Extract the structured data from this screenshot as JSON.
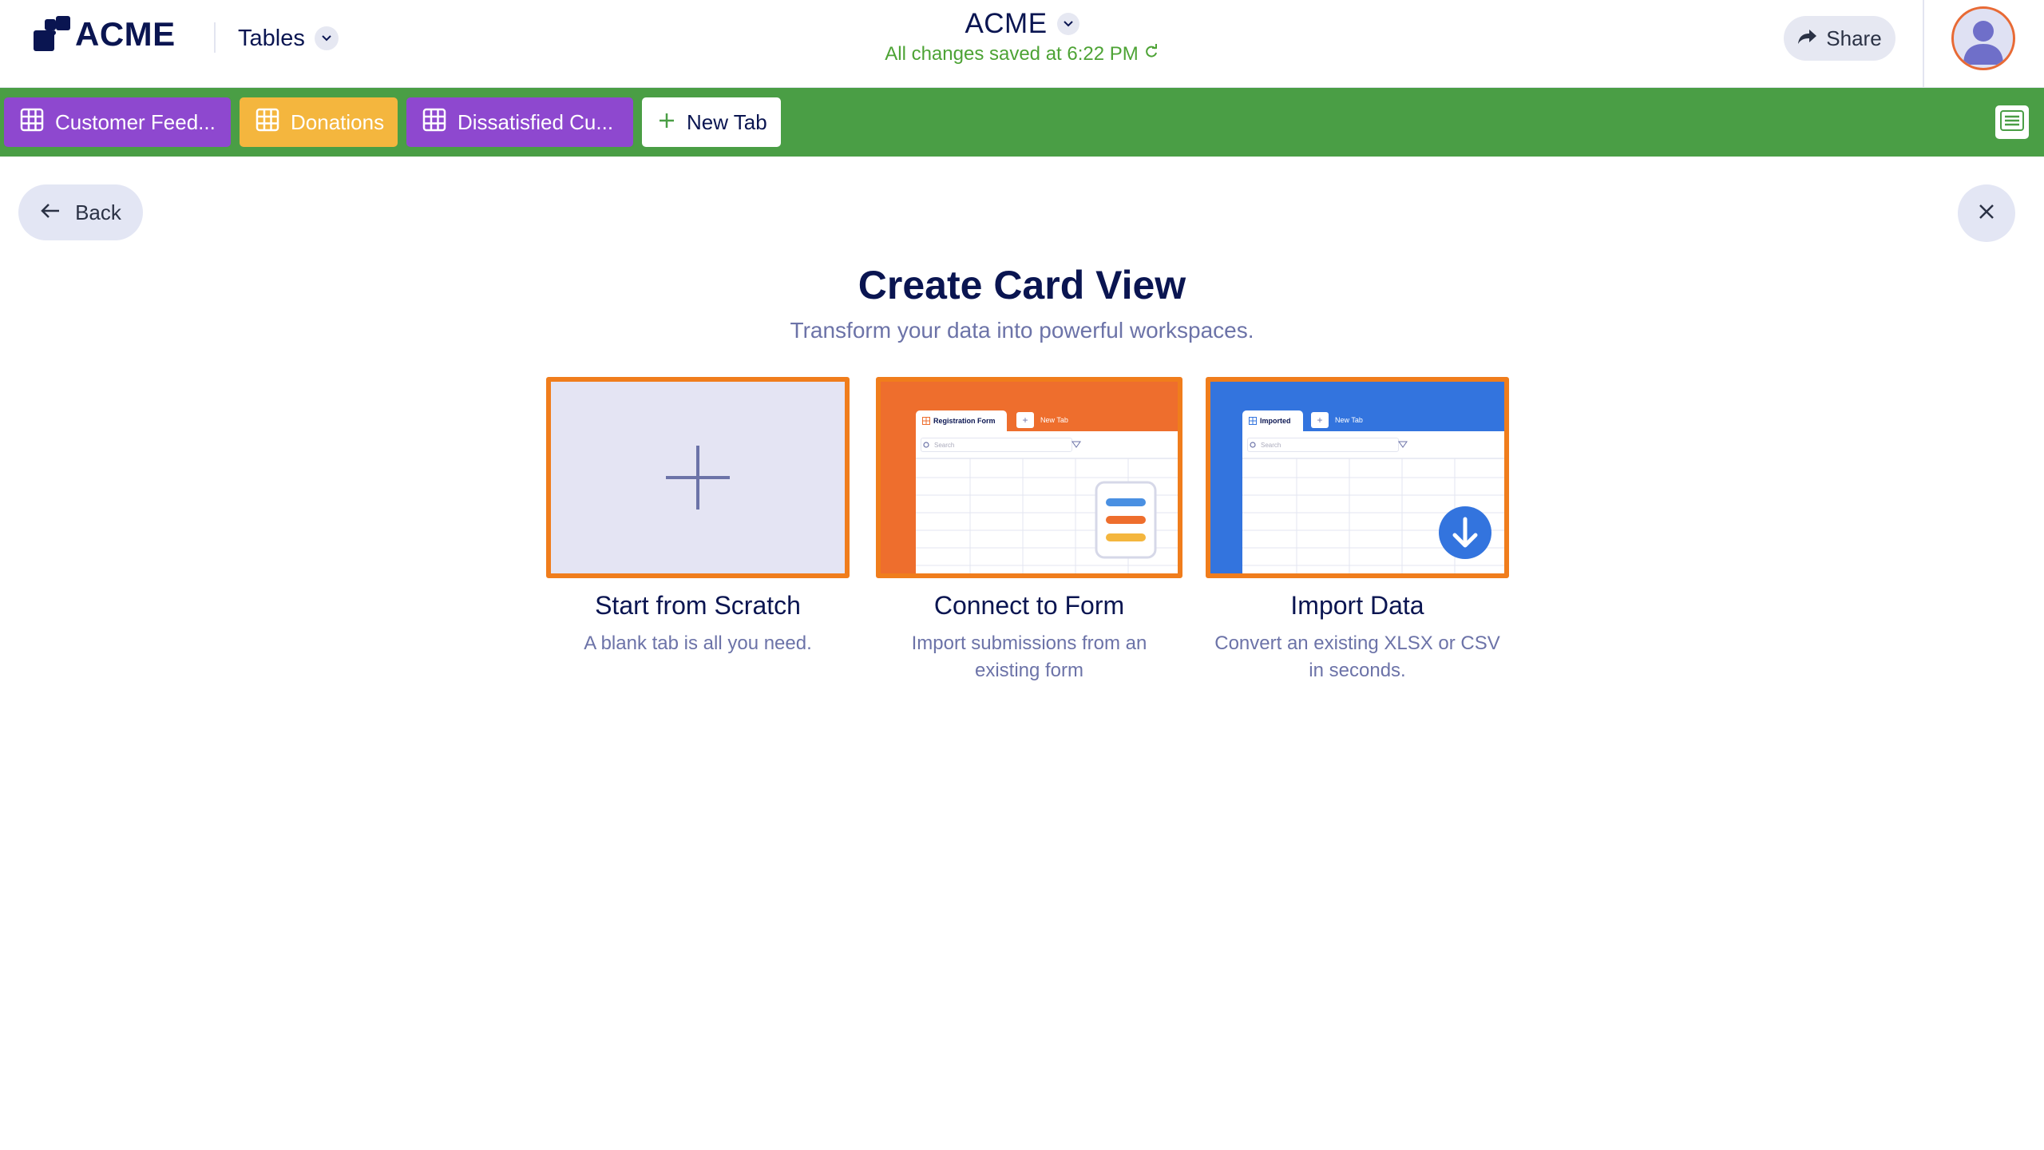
{
  "header": {
    "logo_text": "ACME",
    "tables_label": "Tables",
    "app_title": "ACME",
    "save_status": "All changes saved at 6:22 PM",
    "share_label": "Share"
  },
  "tabs": [
    {
      "label": "Customer Feed...",
      "color": "#8e48cf"
    },
    {
      "label": "Donations",
      "color": "#f4b63e"
    },
    {
      "label": "Dissatisfied Cu...",
      "color": "#8e48cf"
    }
  ],
  "new_tab_label": "New Tab",
  "nav": {
    "back_label": "Back"
  },
  "page": {
    "title": "Create Card View",
    "subtitle": "Transform your data into powerful workspaces."
  },
  "options": [
    {
      "title": "Start from Scratch",
      "desc": "A blank tab is all you need."
    },
    {
      "title": "Connect to Form",
      "desc": "Import submissions from an existing form",
      "preview": {
        "tab_label": "Registration Form",
        "new_tab_label": "New Tab",
        "search_placeholder": "Search"
      }
    },
    {
      "title": "Import Data",
      "desc": "Convert an existing XLSX or CSV in seconds.",
      "preview": {
        "tab_label": "Imported",
        "new_tab_label": "New Tab",
        "search_placeholder": "Search"
      }
    }
  ],
  "colors": {
    "brand_navy": "#0a1551",
    "tabbar_green": "#4a9e45",
    "highlight_orange": "#f07d1c",
    "saved_green": "#4da335",
    "form_orange": "#ee6e2d",
    "import_blue": "#3374de"
  }
}
